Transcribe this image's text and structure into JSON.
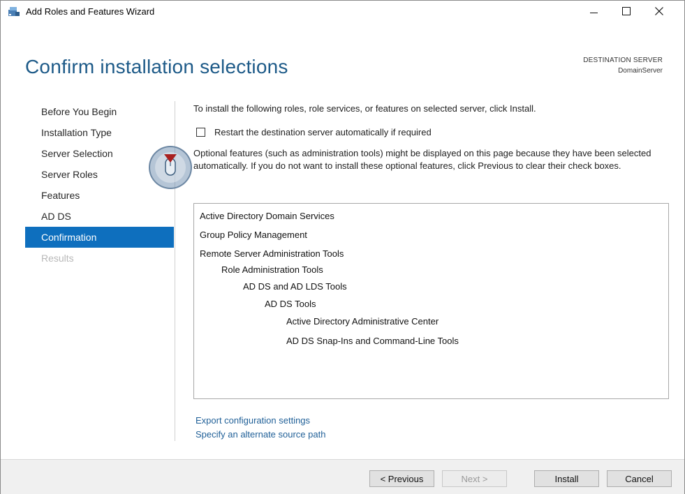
{
  "window": {
    "title": "Add Roles and Features Wizard",
    "icon": "server-manager-icon",
    "minimize_icon": "minimize-icon",
    "maximize_icon": "maximize-icon",
    "close_icon": "close-icon"
  },
  "header": {
    "page_title": "Confirm installation selections",
    "destination_label": "DESTINATION SERVER",
    "destination_value": "DomainServer"
  },
  "nav": {
    "items": [
      {
        "label": "Before You Begin",
        "state": "normal"
      },
      {
        "label": "Installation Type",
        "state": "normal"
      },
      {
        "label": "Server Selection",
        "state": "normal"
      },
      {
        "label": "Server Roles",
        "state": "normal"
      },
      {
        "label": "Features",
        "state": "normal"
      },
      {
        "label": "AD DS",
        "state": "normal"
      },
      {
        "label": "Confirmation",
        "state": "active"
      },
      {
        "label": "Results",
        "state": "disabled"
      }
    ]
  },
  "content": {
    "intro": "To install the following roles, role services, or features on selected server, click Install.",
    "restart_checkbox_label": "Restart the destination server automatically if required",
    "restart_checked": false,
    "optional_note": "Optional features (such as administration tools) might be displayed on this page because they have been selected automatically. If you do not want to install these optional features, click Previous to clear their check boxes.",
    "selections": [
      {
        "label": "Active Directory Domain Services",
        "level": 0
      },
      {
        "label": "Group Policy Management",
        "level": 0
      },
      {
        "label": "Remote Server Administration Tools",
        "level": 0
      },
      {
        "label": "Role Administration Tools",
        "level": 1
      },
      {
        "label": "AD DS and AD LDS Tools",
        "level": 2
      },
      {
        "label": "AD DS Tools",
        "level": 3
      },
      {
        "label": "Active Directory Administrative Center",
        "level": 4
      },
      {
        "label": "AD DS Snap-Ins and Command-Line Tools",
        "level": 4
      }
    ],
    "export_link": "Export configuration settings",
    "alt_source_link": "Specify an alternate source path"
  },
  "footer": {
    "previous": "< Previous",
    "next": "Next >",
    "install": "Install",
    "cancel": "Cancel"
  },
  "colors": {
    "accent": "#0e6fbe",
    "title": "#1d5a88",
    "link": "#1f5f97"
  }
}
